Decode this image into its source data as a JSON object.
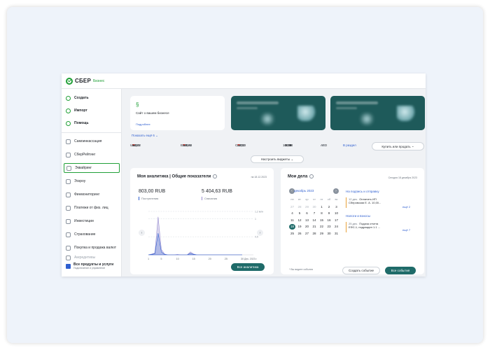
{
  "brand": {
    "name": "СБЕР",
    "sub": "Бизнес"
  },
  "sidebar": {
    "primary": [
      {
        "label": "Создать"
      },
      {
        "label": "Импорт"
      },
      {
        "label": "Помощь"
      }
    ],
    "items": [
      {
        "label": "Самоинкассация"
      },
      {
        "label": "СберРейтинг"
      },
      {
        "label": "Эквайринг"
      },
      {
        "label": "Эскроу"
      },
      {
        "label": "Финмониторинг"
      },
      {
        "label": "Платежи от физ. лиц"
      },
      {
        "label": "Инвестиции"
      },
      {
        "label": "Страхование"
      },
      {
        "label": "Покупка и продажа валют"
      },
      {
        "label": "Аккредитивы"
      }
    ],
    "bottom": {
      "title": "Все продукты и услуги",
      "subtitle": "Подключение и управление"
    }
  },
  "promo": {
    "title": "Сайт о вашем бизнесе",
    "link": "Подробнее"
  },
  "show_more": "Показать ещё 6",
  "rates": {
    "items": [
      {
        "code": "USD",
        "buy": "95,09",
        "buy_dir": "▼",
        "sell": "84,42",
        "sell_dir": "▼"
      },
      {
        "code": "EUR",
        "buy": "103,43",
        "buy_dir": "▼",
        "sell": "92,86",
        "sell_dir": "▼"
      },
      {
        "code": "CNY",
        "buy": "13,00",
        "buy_dir": "▼",
        "sell": "12,13",
        "sell_dir": "▼"
      },
      {
        "code": "10 INR",
        "buy": "10,83",
        "buy_dir": "",
        "sell": "8,74",
        "sell_dir": ""
      },
      {
        "code": "AED",
        "buy": "21",
        "buy_dir": "",
        "sell": "",
        "sell_dir": ""
      }
    ],
    "section_link": "В раздел",
    "buy_sell_button": "Купить или продать"
  },
  "widgets_button": "Настроить виджеты",
  "analytics": {
    "title": "Моя аналитика | Общие показатели",
    "date": "на 18.12.2023",
    "income_amount": "803,00 RUB",
    "income_label": "Поступления",
    "expense_amount": "5 404,63 RUB",
    "expense_label": "Списания",
    "button": "Все аналитика",
    "chart_data": {
      "type": "area",
      "x": [
        1,
        2,
        3,
        4,
        5,
        6,
        7,
        8,
        9,
        10,
        11,
        12,
        13,
        14,
        15,
        16,
        17,
        18,
        19,
        20,
        21,
        22,
        23,
        24,
        25,
        26,
        27,
        28,
        29,
        30
      ],
      "x_tick_labels": [
        "1",
        "5",
        "10",
        "15",
        "20",
        "25",
        "30",
        "Дек. 2023 г."
      ],
      "y_tick_labels": [
        "1,2 млн",
        "1",
        "0,5"
      ],
      "ylim": [
        0,
        1.2
      ],
      "series": [
        {
          "values": [
            0,
            0.02,
            0.05,
            1.05,
            0.15,
            0.02,
            0,
            0,
            0,
            0.01,
            0,
            0,
            0,
            0.08,
            0.02,
            0,
            0,
            0,
            0,
            0,
            0,
            0,
            0,
            0,
            0,
            0,
            0,
            0,
            0,
            0
          ]
        },
        {
          "values": [
            0,
            0.01,
            0.03,
            0.6,
            0.08,
            0.01,
            0,
            0,
            0,
            0,
            0,
            0,
            0,
            0.04,
            0.01,
            0,
            0,
            0,
            0,
            0,
            0,
            0,
            0,
            0,
            0,
            0,
            0,
            0,
            0,
            0
          ]
        }
      ],
      "colors": [
        "#9a8fd0",
        "#2f5fd0"
      ]
    }
  },
  "tasks": {
    "title": "Мои дела",
    "date": "Сегодня 18 декабря 2023",
    "month": "декабрь 2023",
    "weekdays": [
      "пн",
      "вт",
      "ср",
      "чт",
      "пт",
      "сб",
      "вс"
    ],
    "weeks": [
      [
        "27",
        "28",
        "29",
        "30",
        "1",
        "2",
        "3"
      ],
      [
        "4",
        "5",
        "6",
        "7",
        "8",
        "9",
        "10"
      ],
      [
        "11",
        "12",
        "13",
        "14",
        "15",
        "16",
        "17"
      ],
      [
        "18",
        "19",
        "20",
        "21",
        "22",
        "23",
        "24"
      ],
      [
        "25",
        "26",
        "27",
        "28",
        "29",
        "30",
        "31"
      ]
    ],
    "group1": {
      "title": "На подпись и отправку",
      "days": "12 дек.",
      "text1": "Оплатить ИП",
      "text2": "Сберовская Е. А. 10,00...",
      "more": "ещё 2"
    },
    "group2": {
      "title": "Налоги и взносы",
      "days": "25 дек.",
      "text1": "Подача отчета",
      "text2": "ЕФС-1, подраздел 1.1 ...",
      "more": "ещё 7"
    },
    "footnote": "* Вы видите события",
    "create_button": "Создать событие",
    "all_button": "Все события"
  }
}
